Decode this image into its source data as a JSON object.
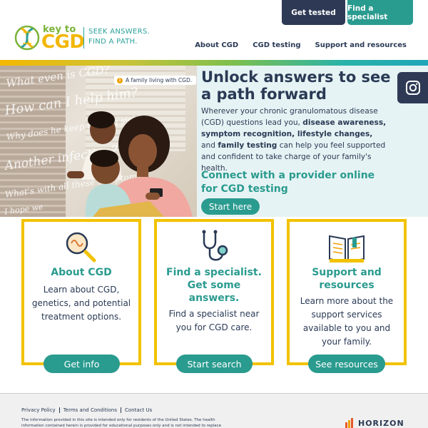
{
  "header": {
    "logo_small": "key to",
    "logo_big": "CGD",
    "tagline_line1": "SEEK ANSWERS.",
    "tagline_line2": "FIND A PATH.",
    "btn_get_tested": "Get tested",
    "btn_find_specialist": "Find a specialist",
    "nav": [
      "About CGD",
      "CGD testing",
      "Support and resources"
    ]
  },
  "hero": {
    "caption": "A family living with CGD.",
    "caption_icon": "info-icon",
    "scribbles": [
      "What even is CGD?",
      "How can I help him?",
      "Why does he keep getting sick?",
      "Another infection?",
      "What's with all these symptoms?",
      "I hope we"
    ],
    "title": "Unlock answers to see a path forward",
    "body_parts": [
      {
        "t": "Wherever your chronic granulomatous disease (CGD) questions lead you, ",
        "b": false
      },
      {
        "t": "disease awareness, symptom recognition, lifestyle changes,",
        "b": true
      },
      {
        "t": " and ",
        "b": false
      },
      {
        "t": "family testing",
        "b": true
      },
      {
        "t": " can help you feel supported and confident to take charge of your family's health.",
        "b": false
      }
    ],
    "subheading": "Connect with a provider online for CGD testing",
    "cta": "Start here"
  },
  "social": {
    "icon": "instagram-icon"
  },
  "cards": [
    {
      "title": "About CGD",
      "desc": "Learn about CGD, genetics, and potential treatment options.",
      "button": "Get info",
      "icon": "magnifier-icon"
    },
    {
      "title": "Find a specialist. Get some answers.",
      "desc": "Find a specialist near you for CGD care.",
      "button": "Start search",
      "icon": "stethoscope-icon"
    },
    {
      "title": "Support and resources",
      "desc": "Learn more about the support services available to you and your family.",
      "button": "See resources",
      "icon": "book-icon"
    }
  ],
  "footer": {
    "links": [
      "Privacy Policy",
      "Terms and Conditions",
      "Contact Us"
    ],
    "disclaimer": "The information provided in this site is intended only for residents of the United States. The health information contained herein is provided for educational purposes only and is not intended to replace",
    "brand": "HORIZON"
  },
  "colors": {
    "teal": "#2a9b8f",
    "navy": "#2e3a55",
    "yellow": "#f2c200",
    "green": "#7bb33a"
  }
}
